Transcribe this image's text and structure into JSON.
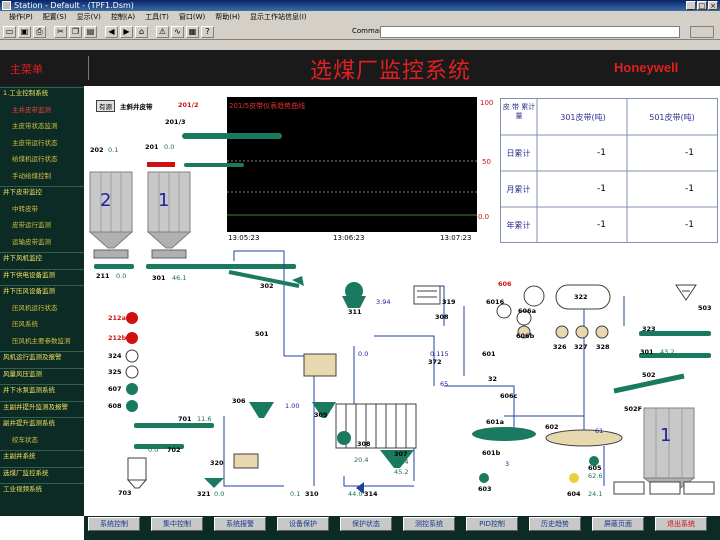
{
  "window": {
    "title": "Station - Default - (TPF1.Dsm)",
    "controls": [
      "_",
      "□",
      "×"
    ]
  },
  "menu": [
    "操作(P)",
    "配置(S)",
    "显示(V)",
    "控制(A)",
    "工具(T)",
    "窗口(W)",
    "帮助(H)",
    "显示工作站信息(I)"
  ],
  "toolbar": {
    "icons": [
      "open-icon",
      "save-icon",
      "print-icon",
      "cut-icon",
      "copy-icon",
      "paste-icon",
      "back-icon",
      "forward-icon",
      "home-icon",
      "alarm-icon",
      "trend-icon",
      "report-icon",
      "help-icon"
    ],
    "command_label": "Command",
    "command_value": ""
  },
  "header": {
    "main_button": "主菜单",
    "title": "选煤厂监控系统",
    "brand": "Honeywell"
  },
  "nav": [
    {
      "label": "1.工业控制系统",
      "level": 1
    },
    {
      "label": "主井皮带监测",
      "level": 2,
      "selected": true
    },
    {
      "label": "主皮带状态监测",
      "level": 2
    },
    {
      "label": "主皮带运行状态",
      "level": 2
    },
    {
      "label": "给煤机运行状态",
      "level": 2
    },
    {
      "label": "手动给煤控制",
      "level": 2
    },
    {
      "label": "并下皮带监控",
      "level": 1
    },
    {
      "label": "中转皮带",
      "level": 2
    },
    {
      "label": "皮带运行监测",
      "level": 2
    },
    {
      "label": "运输皮带监测",
      "level": 2
    },
    {
      "label": "井下风机监控",
      "level": 1
    },
    {
      "label": "井下供电设备监测",
      "level": 1
    },
    {
      "label": "井下压风设备监测",
      "level": 1
    },
    {
      "label": "压风机运行状态",
      "level": 2
    },
    {
      "label": "压风系统",
      "level": 2
    },
    {
      "label": "压风机主要参数监测",
      "level": 2
    },
    {
      "label": "风机运行监测及报警",
      "level": 1
    },
    {
      "label": "风量风压监测",
      "level": 1
    },
    {
      "label": "井下水泵监测系统",
      "level": 1
    },
    {
      "label": "主副井提升监测及报警",
      "level": 1
    },
    {
      "label": "副井提升监测系统",
      "level": 1
    },
    {
      "label": "绞车状态",
      "level": 2
    },
    {
      "label": "主副井系统",
      "level": 1
    },
    {
      "label": "选煤厂监控系统",
      "level": 1
    },
    {
      "label": "工业视频系统",
      "level": 1
    }
  ],
  "trend": {
    "title": "201/5皮带仪表趋势曲线",
    "y_max": "100",
    "y_mid": "50",
    "y_min": "0.0",
    "times": [
      "13:05:23",
      "13:06:23",
      "13:07:23"
    ]
  },
  "summary_table": {
    "corner": "皮 带 累计量",
    "col1": "301皮带(吨)",
    "col2": "501皮带(吨)",
    "rows": [
      {
        "label": "日累计",
        "v1": "-1",
        "v2": "-1"
      },
      {
        "label": "月累计",
        "v1": "-1",
        "v2": "-1"
      },
      {
        "label": "年累计",
        "v1": "-1",
        "v2": "-1"
      }
    ]
  },
  "process": {
    "belt_label": "主斜井皮带",
    "belt_code": "201/2",
    "belt_code2": "201/3",
    "belt_tag": "有源",
    "b202": "202",
    "b202v": "0.1",
    "b201": "201",
    "b201v": "0.0",
    "bin_left": "2",
    "bin_right": "1",
    "bin_big": "1",
    "b211": "211",
    "b211v": "0.0",
    "b301": "301",
    "b301v": "46.1",
    "b302": "302",
    "b311": "311",
    "v394": "3.94",
    "b501": "501",
    "b319": "319",
    "b308": "308",
    "b606": "606",
    "b322": "322",
    "b503": "503",
    "b323": "323",
    "b326": "326",
    "b327": "327",
    "b328": "328",
    "b601": "601",
    "b301b": "301",
    "b301bv": "43.2",
    "b502": "502",
    "b502f": "502F",
    "pump_labels": [
      "212a",
      "212b",
      "324",
      "325",
      "607",
      "608"
    ],
    "b306": "306",
    "v100": "1.00",
    "b305": "305",
    "b701": "701",
    "b701v": "11.6",
    "b307": "307",
    "b307v": "48.4",
    "b307v2": "45.2",
    "v204": "20.4",
    "b308b": "308",
    "b702": "702",
    "b702v": "0.0",
    "b320": "320",
    "b703": "703",
    "b321": "321",
    "b321v": "0.0",
    "b310": "310",
    "b310v": "0.1",
    "b314": "314",
    "b314v": "44.0",
    "b604": "604",
    "b604v": "24.1",
    "b603": "603",
    "b605": "605",
    "b605v": "62.6",
    "b601a": "601a",
    "b601b": "601b",
    "b602": "602",
    "v61": "61",
    "v3": "3",
    "v65": "65",
    "b372": "372",
    "v0115": "0.115",
    "v0": "0.0",
    "b606b": "606b",
    "b606c": "606c",
    "b606a": "606a",
    "b6016": "6016",
    "b32": "32"
  },
  "bottom_buttons": [
    "系统控制",
    "集中控制",
    "系统报警",
    "设备保护",
    "保护状态",
    "测控系统",
    "PID控制",
    "历史趋势",
    "屏蔽页面",
    "退出系统"
  ],
  "colors": {
    "header_bg": "#1a1a1a",
    "nav_bg": "#0b2b24",
    "title_red": "#e02020",
    "equip_green": "#1a7a60",
    "bin_blue": "#1a38c8"
  }
}
